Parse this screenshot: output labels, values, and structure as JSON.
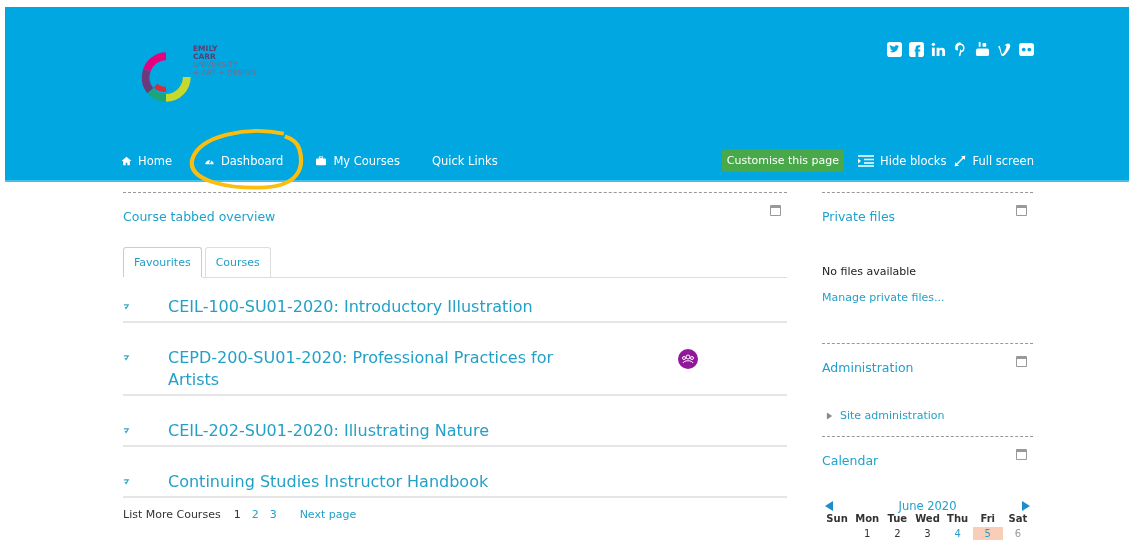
{
  "header": {
    "logo_lines": [
      "EMILY",
      "CARR",
      "UNIVERSITY",
      "+ ART + DESIGN"
    ],
    "social": [
      {
        "kind": "twitter"
      },
      {
        "kind": "facebook"
      },
      {
        "kind": "linkedin"
      },
      {
        "kind": "pinterest"
      },
      {
        "kind": "youtube"
      },
      {
        "kind": "vimeo"
      },
      {
        "kind": "flickr"
      }
    ],
    "nav": [
      {
        "label": "Home",
        "kind": "home",
        "highlighted": false
      },
      {
        "label": "Dashboard",
        "kind": "dashboard",
        "highlighted": true
      },
      {
        "label": "My Courses",
        "kind": "courses",
        "highlighted": false
      },
      {
        "label": "Quick Links",
        "kind": "plain",
        "highlighted": false
      }
    ],
    "customise_button": "Customise this page",
    "hide_blocks": "Hide blocks",
    "full_screen": "Full screen"
  },
  "overview": {
    "title": "Course tabbed overview",
    "tabs": [
      {
        "label": "Favourites",
        "selected": true
      },
      {
        "label": "Courses",
        "selected": false
      }
    ],
    "courses": [
      {
        "title": "CEIL-100-SU01-2020: Introductory Illustration",
        "group_badge": false
      },
      {
        "title": "CEPD-200-SU01-2020: Professional Practices for Artists",
        "group_badge": true
      },
      {
        "title": "CEIL-202-SU01-2020: Illustrating Nature",
        "group_badge": false
      },
      {
        "title": "Continuing Studies Instructor Handbook",
        "group_badge": false
      }
    ],
    "pagination": {
      "label": "List More Courses",
      "pages": [
        {
          "label": "1",
          "selected": true
        },
        {
          "label": "2",
          "selected": false
        },
        {
          "label": "3",
          "selected": false
        }
      ],
      "next": "Next page"
    }
  },
  "private_files": {
    "title": "Private files",
    "empty": "No files available",
    "manage": "Manage private files..."
  },
  "administration": {
    "title": "Administration",
    "items": [
      {
        "label": "Site administration",
        "expanded": false
      }
    ]
  },
  "calendar": {
    "title": "Calendar",
    "month": "June 2020",
    "weekdays": [
      "Sun",
      "Mon",
      "Tue",
      "Wed",
      "Thu",
      "Fri",
      "Sat"
    ],
    "days": [
      {
        "kind": "blank"
      },
      {
        "label": "1",
        "kind": "plain",
        "today": false
      },
      {
        "label": "2",
        "kind": "plain",
        "today": false
      },
      {
        "label": "3",
        "kind": "plain",
        "today": false
      },
      {
        "label": "4",
        "kind": "event",
        "today": false
      },
      {
        "label": "5",
        "kind": "event",
        "today": true
      },
      {
        "label": "6",
        "kind": "weekend",
        "today": false
      }
    ]
  }
}
